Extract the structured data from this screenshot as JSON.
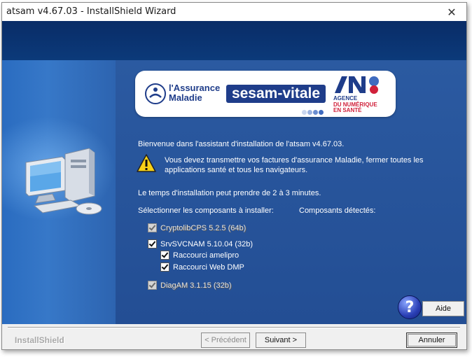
{
  "window": {
    "title": "atsam v4.67.03 - InstallShield Wizard",
    "close_glyph": "✕"
  },
  "logos": {
    "assurance_maladie_line1": "l'Assurance",
    "assurance_maladie_line2": "Maladie",
    "sesam_vitale": "sesam-vitale",
    "ans_line1": "AGENCE",
    "ans_line2": "DU NUMÉRIQUE",
    "ans_line3": "EN SANTÉ"
  },
  "content": {
    "welcome": "Bienvenue dans l'assistant d'installation de l'atsam v4.67.03.",
    "warning": "Vous devez transmettre vos factures d'assurance Maladie, fermer toutes les applications santé et tous les navigateurs.",
    "duration": "Le temps d'installation peut prendre de 2 à 3 minutes.",
    "select_label": "Sélectionner les composants à installer:",
    "detected_label": "Composants détectés:",
    "components": [
      {
        "label": "CryptolibCPS 5.2.5 (64b)",
        "checked": true,
        "disabled": true
      },
      {
        "label": "SrvSVCNAM 5.10.04 (32b)",
        "checked": true,
        "disabled": false
      },
      {
        "label": "Raccourci amelipro",
        "checked": true,
        "disabled": false
      },
      {
        "label": "Raccourci Web DMP",
        "checked": true,
        "disabled": false
      },
      {
        "label": "DiagAM 3.1.15 (32b)",
        "checked": true,
        "disabled": true
      }
    ],
    "help_glyph": "?",
    "help_button": "Aide"
  },
  "footer": {
    "brand": "InstallShield",
    "prev_button": "< Précédent",
    "next_button": "Suivant >",
    "cancel_button": "Annuler"
  },
  "icons": {
    "warning": "warning-icon",
    "help": "help-icon",
    "close": "close-icon",
    "computer": "computer-icon"
  },
  "colors": {
    "content_bg": "#2b5aa1",
    "top_band": "#0a2c67",
    "sesam_blue": "#1f3d8a",
    "ans_red": "#d0203a"
  }
}
